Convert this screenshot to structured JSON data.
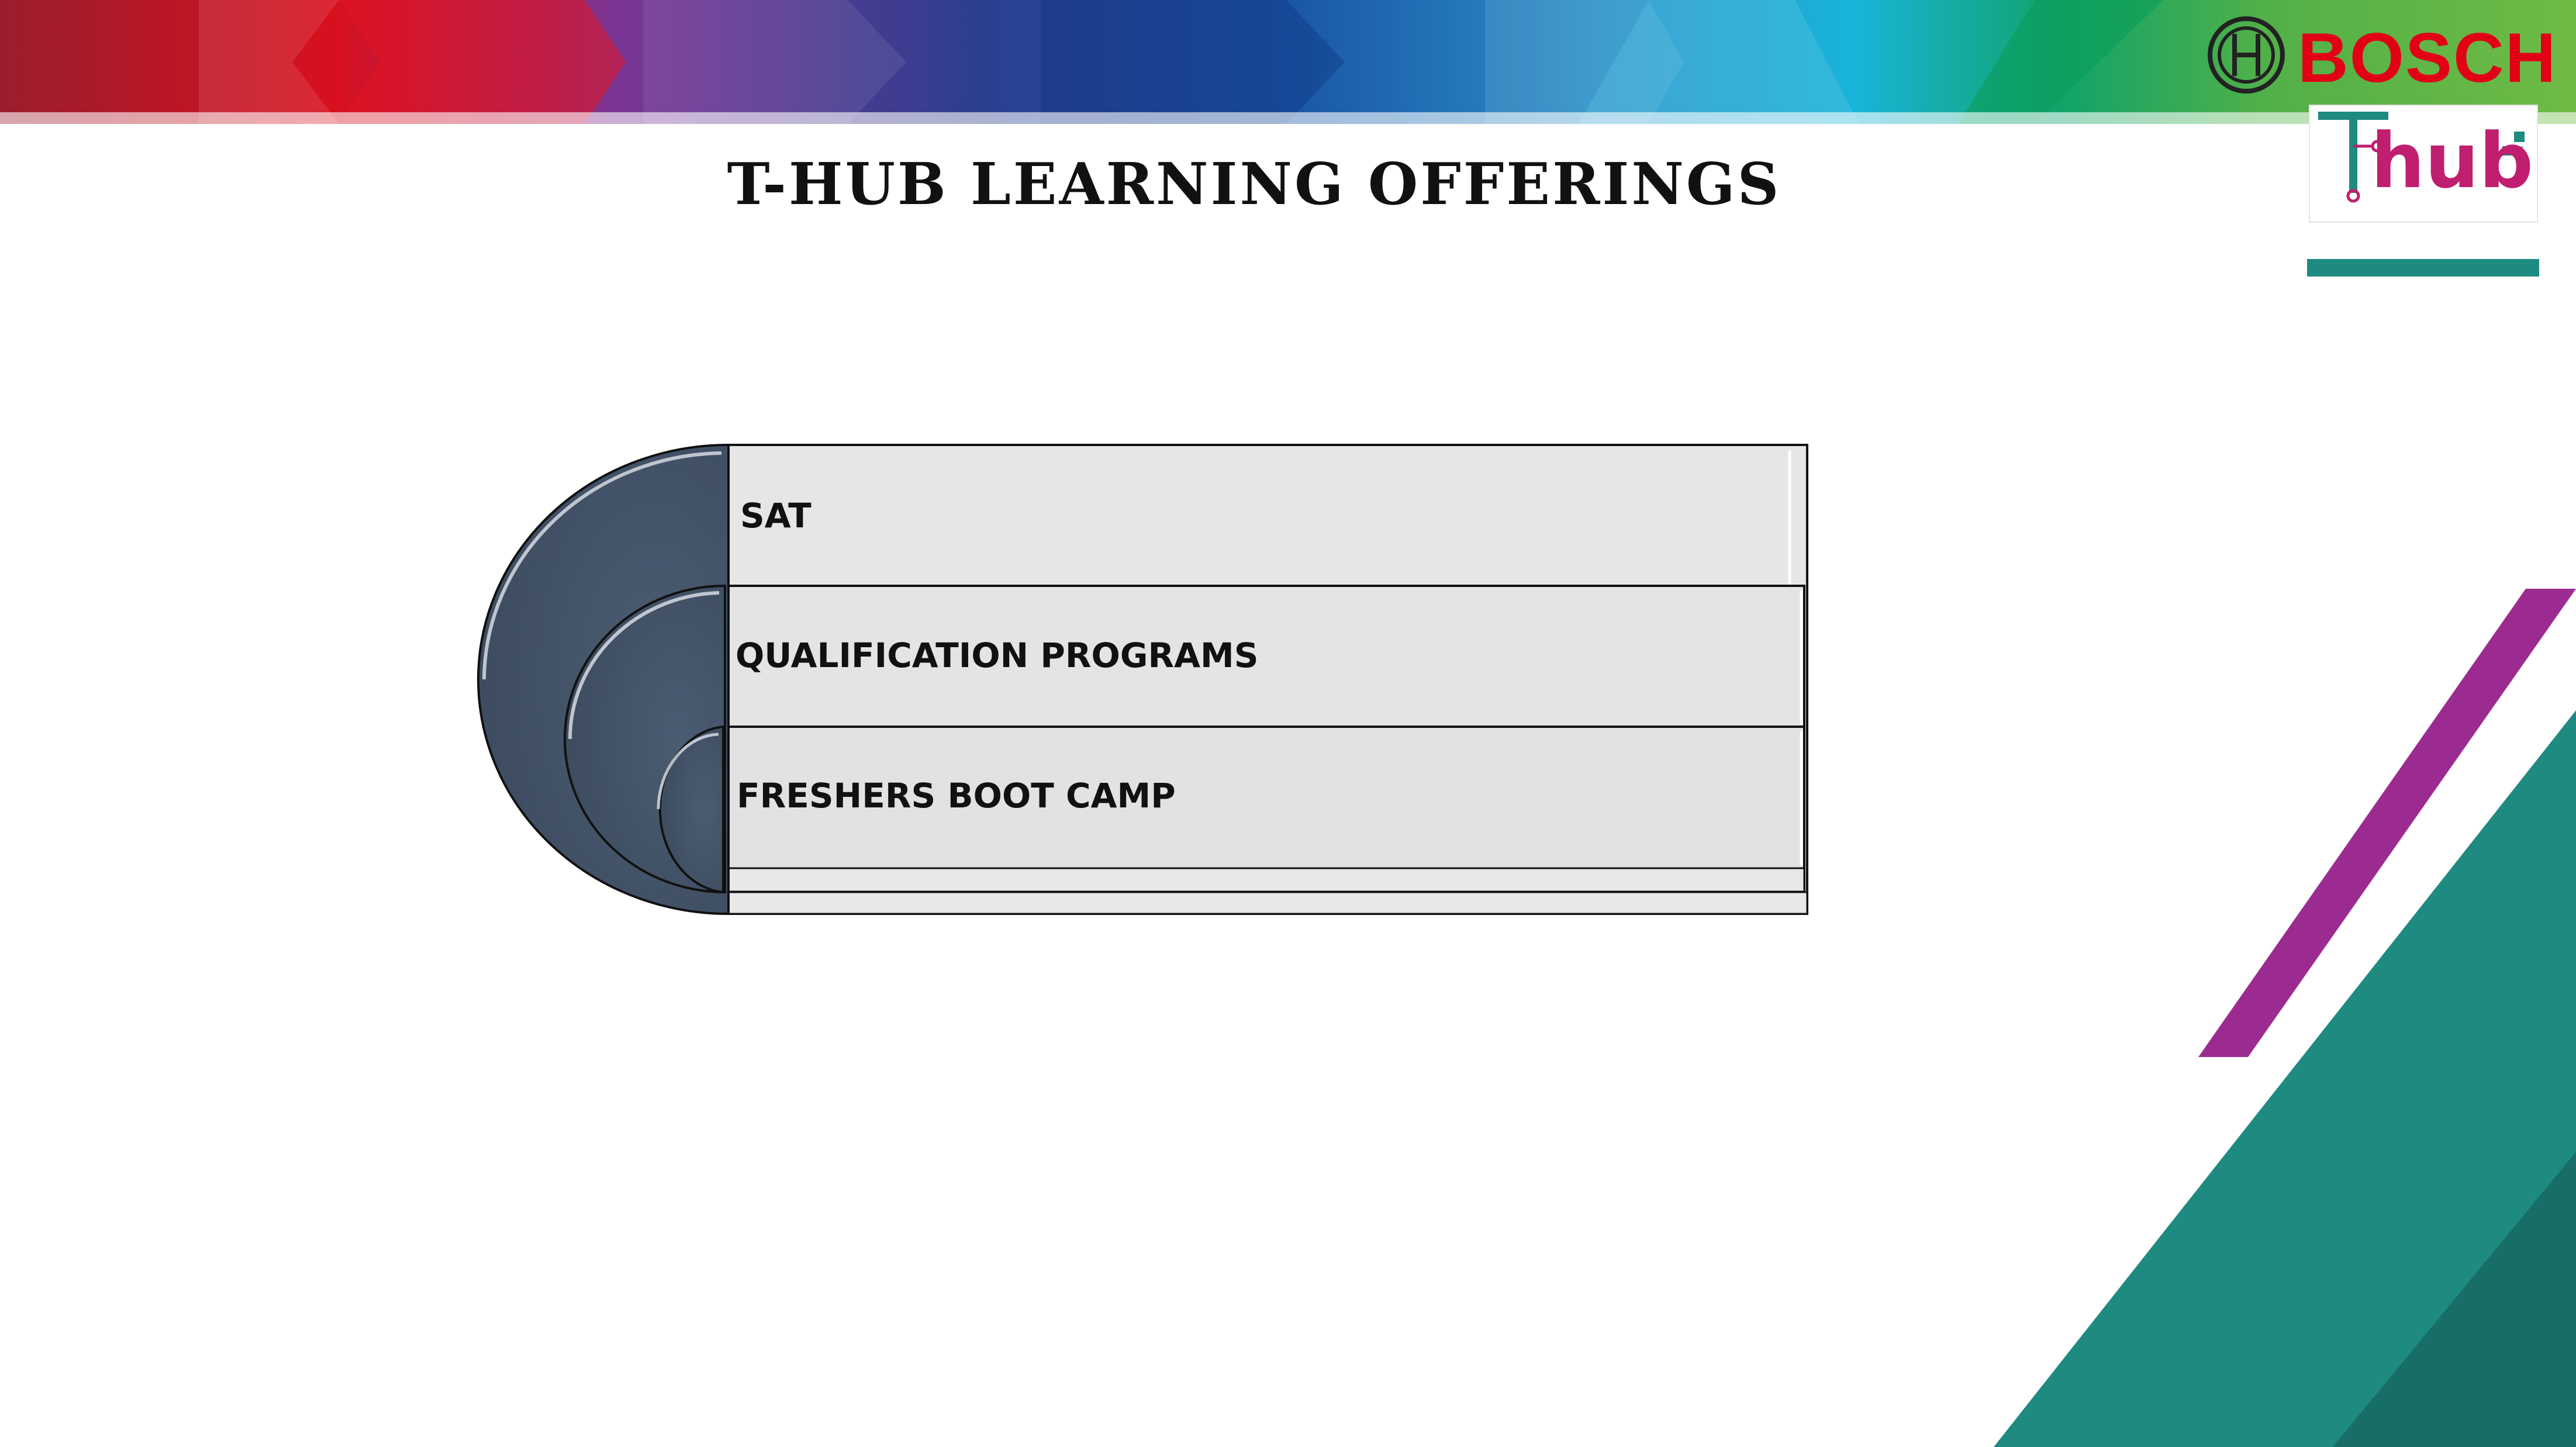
{
  "slide": {
    "title": "T-HUB LEARNING OFFERINGS",
    "brand": "BOSCH",
    "logo_text": "hub",
    "layers": [
      {
        "label": "SAT"
      },
      {
        "label": "QUALIFICATION PROGRAMS"
      },
      {
        "label": "FRESHERS BOOT CAMP"
      }
    ]
  },
  "colors": {
    "bosch_red": "#e20015",
    "arc_fill": "#46566b",
    "panel_fill": "#e6e6e6",
    "teal": "#1f8a80",
    "magenta": "#9b2b91"
  }
}
